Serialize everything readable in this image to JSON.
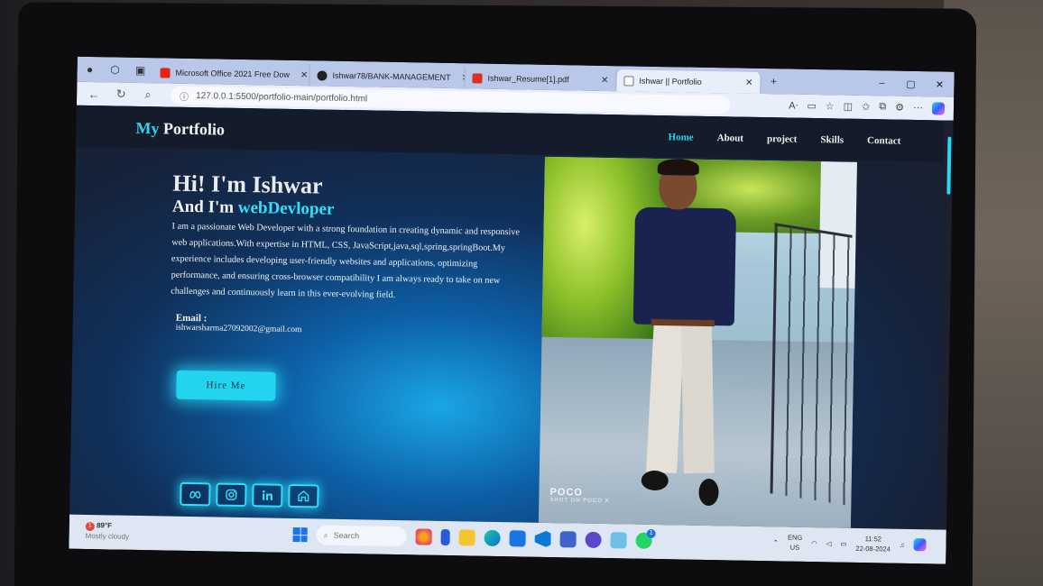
{
  "tabs": [
    {
      "title": "Microsoft Office 2021 Free Dow",
      "icon": "youtube-icon"
    },
    {
      "title": "Ishwar78/BANK-MANAGEMENT",
      "icon": "github-icon"
    },
    {
      "title": "Ishwar_Resume[1].pdf",
      "icon": "pdf-icon"
    },
    {
      "title": "Ishwar || Portfolio",
      "icon": "page-icon",
      "active": true
    }
  ],
  "address": {
    "url": "127.0.0.1:5500/portfolio-main/portfolio.html"
  },
  "site": {
    "logo_my": "My",
    "logo_rest": " Portfolio",
    "nav": [
      "Home",
      "About",
      "project",
      "Skills",
      "Contact"
    ],
    "active_nav": "Home"
  },
  "hero": {
    "greeting": "Hi! I'm Ishwar",
    "subtitle_prefix": "And I'm ",
    "role": "webDevloper",
    "bio": "I am a passionate Web Developer with a strong foundation in creating dynamic and responsive web applications.With expertise in HTML, CSS, JavaScript,java,sql,spring,springBoot.My experience includes developing user-friendly websites and applications, optimizing performance, and ensuring cross-browser compatibility I am always ready to take on new challenges and continuously learn in this ever-evolving field.",
    "email_label": "Email :",
    "email": "ishwarsharma27092002@gmail.com",
    "hire_button": "Hire Me",
    "socials": [
      "meta-icon",
      "instagram-icon",
      "linkedin-icon",
      "home-icon"
    ]
  },
  "photo": {
    "watermark_brand": "POCO",
    "watermark_sub": "SHOT ON POCO X"
  },
  "taskbar": {
    "temperature": "89°F",
    "weather_desc": "Mostly cloudy",
    "weather_badge": "1",
    "search_placeholder": "Search",
    "lang_top": "ENG",
    "lang_bottom": "US",
    "time": "11:52",
    "date": "22-08-2024",
    "notification_badge": "1"
  },
  "colors": {
    "accent": "#2fd6f0",
    "page_bg": "#16223a",
    "glow": "#23d4ee"
  }
}
